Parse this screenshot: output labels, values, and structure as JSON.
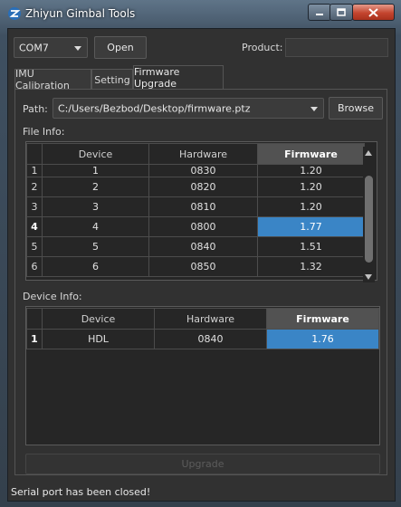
{
  "window": {
    "title": "Zhiyun Gimbal Tools",
    "icon": "zhiyun-gimbal-icon",
    "controls": {
      "minimize": "minimize-icon",
      "maximize": "maximize-icon",
      "close": "close-icon"
    }
  },
  "connection": {
    "port_value": "COM7",
    "open_label": "Open",
    "product_label": "Product:",
    "product_value": ""
  },
  "tabs": [
    {
      "label": "IMU Calibration",
      "active": false
    },
    {
      "label": "Setting",
      "active": false
    },
    {
      "label": "Firmware Upgrade",
      "active": true
    }
  ],
  "firmware": {
    "path_label": "Path:",
    "path_value": "C:/Users/Bezbod/Desktop/firmware.ptz",
    "browse_label": "Browse",
    "file_info_label": "File Info:",
    "file_table": {
      "columns": [
        "Device",
        "Hardware",
        "Firmware"
      ],
      "rows": [
        {
          "num": "1",
          "device": "1",
          "hardware": "0830",
          "firmware": "1.20"
        },
        {
          "num": "2",
          "device": "2",
          "hardware": "0820",
          "firmware": "1.20"
        },
        {
          "num": "3",
          "device": "3",
          "hardware": "0810",
          "firmware": "1.20"
        },
        {
          "num": "4",
          "device": "4",
          "hardware": "0800",
          "firmware": "1.77"
        },
        {
          "num": "5",
          "device": "5",
          "hardware": "0840",
          "firmware": "1.51"
        },
        {
          "num": "6",
          "device": "6",
          "hardware": "0850",
          "firmware": "1.32"
        }
      ],
      "selected_row": "4"
    },
    "device_info_label": "Device Info:",
    "device_table": {
      "columns": [
        "Device",
        "Hardware",
        "Firmware"
      ],
      "rows": [
        {
          "num": "1",
          "device": "HDL",
          "hardware": "0840",
          "firmware": "1.76"
        }
      ]
    },
    "upgrade_label": "Upgrade"
  },
  "status_text": "Serial port has been closed!",
  "colors": {
    "selection": "#3a85c6",
    "background": "#313131",
    "header_active": "#525252"
  }
}
